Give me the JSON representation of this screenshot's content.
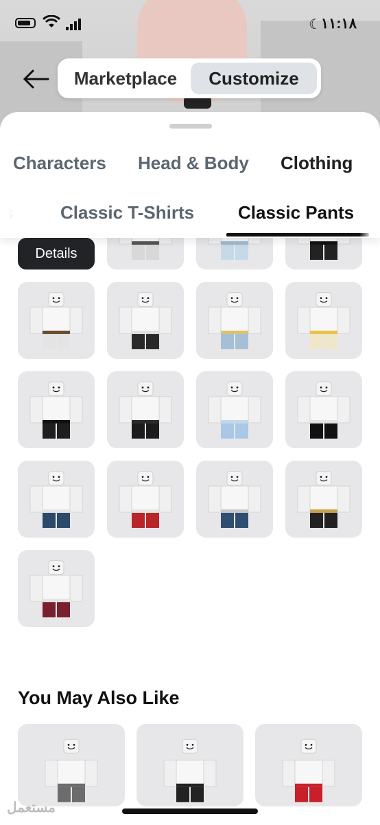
{
  "status_bar": {
    "time": "١١:١٨"
  },
  "header": {
    "segments": [
      {
        "label": "Marketplace",
        "selected": false
      },
      {
        "label": "Customize",
        "selected": true
      }
    ]
  },
  "category_tabs": [
    {
      "label": "Characters",
      "active": false
    },
    {
      "label": "Head & Body",
      "active": false
    },
    {
      "label": "Clothing",
      "active": true
    }
  ],
  "subcategory_tabs": [
    {
      "label": "ts",
      "active": false
    },
    {
      "label": "Classic T-Shirts",
      "active": false
    },
    {
      "label": "Classic Pants",
      "active": true
    }
  ],
  "details_button": "Details",
  "colors": {
    "accent_dark": "#222327",
    "tile_bg": "#e7e7ea",
    "segment_selected": "#dfe3e8"
  },
  "items": [
    {
      "pants": "#d8d8d8",
      "belt": "#555555"
    },
    {
      "pants": "#c6d9e8",
      "belt": "#9fbad0"
    },
    {
      "pants": "#222222",
      "belt": "#111111"
    },
    {
      "pants": "#e4e4e4",
      "belt": "#6b4a2e"
    },
    {
      "pants": "#2a2a2a",
      "belt": "#e0e0e0"
    },
    {
      "pants": "#a7bfd6",
      "belt": "#d9c36a"
    },
    {
      "pants": "#f0e6c8",
      "belt": "#e8c24a"
    },
    {
      "pants": "#1e1e1e",
      "belt": "#111111"
    },
    {
      "pants": "#1c1c1c",
      "belt": "#2b2b2b"
    },
    {
      "pants": "#a9c7e6",
      "belt": "#c4d8ec"
    },
    {
      "pants": "#111111",
      "belt": "#e4e4e4"
    },
    {
      "pants": "#2b4a6b",
      "belt": "#e4e4e4"
    },
    {
      "pants": "#b9262a",
      "belt": "#e4e4e4"
    },
    {
      "pants": "#2f4e72",
      "belt": "#c8c8c8"
    },
    {
      "pants": "#222222",
      "belt": "#c8a24a"
    },
    {
      "pants": "#7a1f2c",
      "belt": "#e4e4e4"
    }
  ],
  "recommendations": {
    "title": "You May Also Like",
    "items": [
      {
        "pants": "#6c6c6c"
      },
      {
        "pants": "#222222"
      },
      {
        "pants": "#c8202a"
      }
    ]
  },
  "watermark": "مستعمل"
}
